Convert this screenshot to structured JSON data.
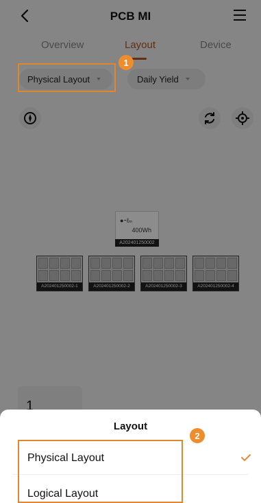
{
  "header": {
    "title": "PCB MI"
  },
  "tabs": [
    {
      "label": "Overview"
    },
    {
      "label": "Layout"
    },
    {
      "label": "Device"
    }
  ],
  "filters": {
    "layout_select": "Physical Layout",
    "metric_select": "Daily Yield"
  },
  "layout": {
    "battery": {
      "capacity": "400Wh",
      "id": "A202401250002"
    },
    "panels": [
      {
        "id": "A202401250002-1"
      },
      {
        "id": "A202401250002-2"
      },
      {
        "id": "A202401250002-3"
      },
      {
        "id": "A202401250002-4"
      }
    ]
  },
  "count_card": {
    "value": "1"
  },
  "sheet": {
    "title": "Layout",
    "options": [
      {
        "label": "Physical Layout",
        "selected": true
      },
      {
        "label": "Logical Layout",
        "selected": false
      }
    ]
  },
  "annotations": {
    "badge_1": "1",
    "badge_2": "2"
  },
  "colors": {
    "accent": "#b5561f",
    "annotation": "#e0862d",
    "check": "#e38a3a"
  }
}
